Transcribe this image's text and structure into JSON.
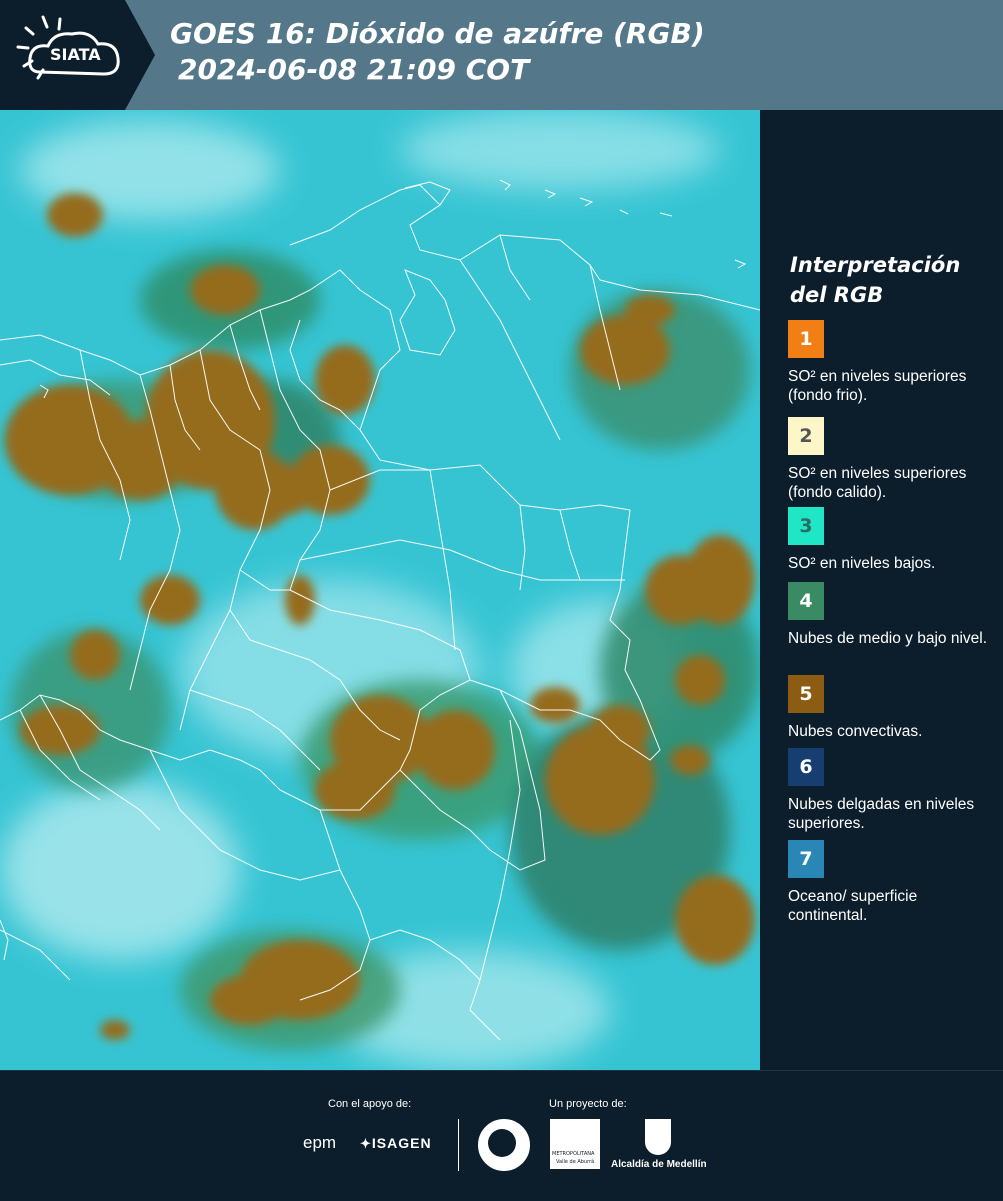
{
  "header": {
    "logo_text": "SIATA",
    "title_line1": "GOES 16: Dióxido de azúfre (RGB)",
    "title_line2": "2024-06-08 21:09 COT"
  },
  "legend": {
    "title": "Interpretación del RGB",
    "items": [
      {
        "number": "1",
        "color": "#f27f16",
        "number_color": "#ffffff",
        "text": "SO² en niveles superiores (fondo frio)."
      },
      {
        "number": "2",
        "color": "#fdf6c9",
        "number_color": "#555555",
        "text": "SO² en niveles superiores (fondo calido)."
      },
      {
        "number": "3",
        "color": "#1fe6c4",
        "number_color": "#2b6b64",
        "text": "SO² en niveles bajos."
      },
      {
        "number": "4",
        "color": "#3a8a64",
        "number_color": "#ffffff",
        "text": "Nubes de medio y bajo nivel."
      },
      {
        "number": "5",
        "color": "#8b5c12",
        "number_color": "#ffffff",
        "text": "Nubes convectivas."
      },
      {
        "number": "6",
        "color": "#173e70",
        "number_color": "#ffffff",
        "text": "Nubes delgadas en niveles superiores."
      },
      {
        "number": "7",
        "color": "#2a86b5",
        "number_color": "#ffffff",
        "text": "Oceano/ superficie continental."
      }
    ]
  },
  "footer": {
    "support_label": "Con el apoyo de:",
    "project_label": "Un proyecto de:",
    "sponsors": [
      "epm",
      "ISAGEN"
    ],
    "partners": [
      "Área Metropolitana Valle de Aburrá",
      "Alcaldía de Medellín"
    ],
    "area_sub": "METROPOLITANA",
    "area_sub2": "Valle de Aburrá"
  },
  "map": {
    "ocean_color": "#39c6d4",
    "convective_color": "#8f6a1c",
    "border_color": "#ffffff"
  }
}
